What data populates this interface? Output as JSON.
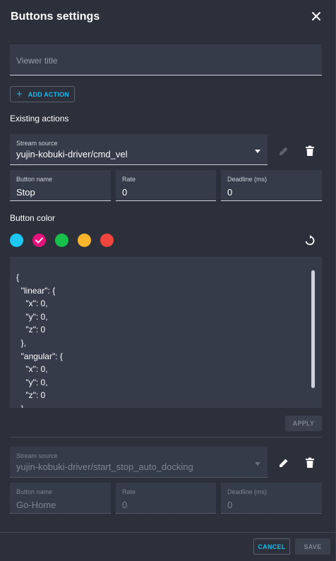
{
  "dialog": {
    "title": "Buttons settings",
    "close_icon": "close-icon"
  },
  "viewer_title": {
    "placeholder": "Viewer title",
    "value": ""
  },
  "add_action": {
    "icon": "+",
    "label": "ADD ACTION"
  },
  "existing_actions_label": "Existing actions",
  "actions": [
    {
      "stream_source": {
        "label": "Stream source",
        "value": "yujin-kobuki-driver/cmd_vel"
      },
      "button_name": {
        "label": "Button name",
        "value": "Stop"
      },
      "rate": {
        "label": "Rate",
        "value": "0"
      },
      "deadline": {
        "label": "Deadline (ms)",
        "value": "0"
      },
      "button_color_label": "Button color",
      "colors": [
        "#1ec8f5",
        "#e3127c",
        "#17c04b",
        "#fbb52a",
        "#f2453d"
      ],
      "selected_color": "#e3127c",
      "json_text": "{\n  \"linear\": {\n    \"x\": 0,\n    \"y\": 0,\n    \"z\": 0\n  },\n  \"angular\": {\n    \"x\": 0,\n    \"y\": 0,\n    \"z\": 0\n  }\n}",
      "apply_label": "APPLY"
    },
    {
      "stream_source": {
        "label": "Stream source",
        "value": "yujin-kobuki-driver/start_stop_auto_docking"
      },
      "button_name": {
        "label": "Button name",
        "value": "Go-Home"
      },
      "rate": {
        "label": "Rate",
        "value": "0"
      },
      "deadline": {
        "label": "Deadline (ms)",
        "value": "0"
      }
    }
  ],
  "footer": {
    "cancel_label": "CANCEL",
    "save_label": "SAVE"
  },
  "colors": {
    "background": "#2b303b",
    "field_bg": "#353b48",
    "accent": "#21b6e8"
  }
}
